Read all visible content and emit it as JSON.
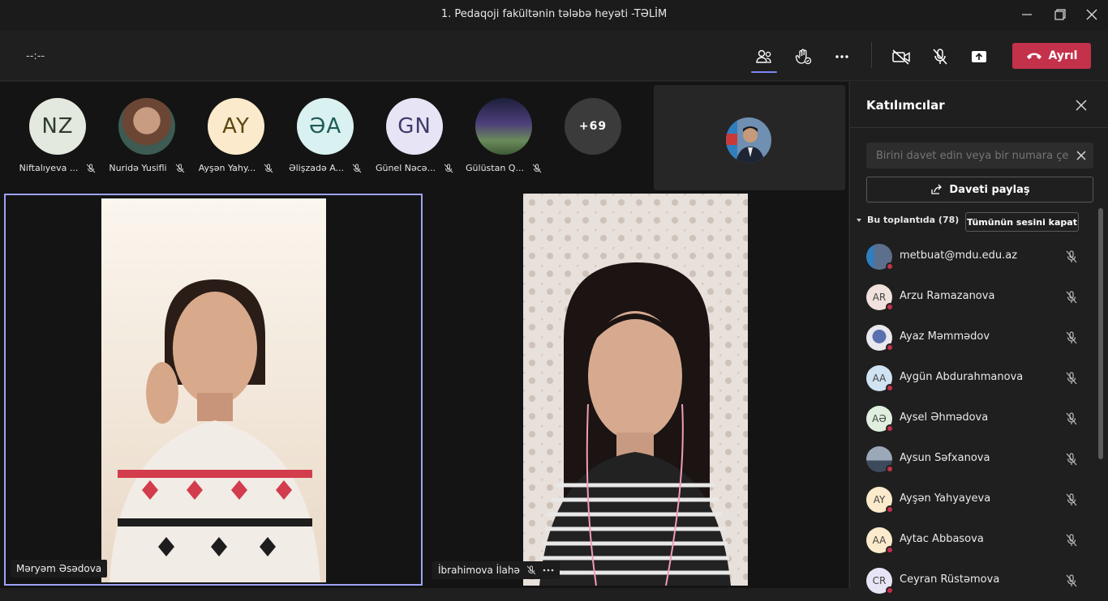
{
  "window": {
    "title": "1. Pedaqoji fakültənin tələbə heyəti -TƏLİM"
  },
  "toolbar": {
    "timer": "--:--",
    "leave_label": "Ayrıl"
  },
  "strip": {
    "participants": [
      {
        "initials": "NZ",
        "name": "Niftalıyeva ...",
        "bg": "#e3e9df",
        "fg": "#2f3b2c"
      },
      {
        "initials": "",
        "name": "Nuridə Yusifli",
        "bg": "#8a6a55",
        "fg": "#fff"
      },
      {
        "initials": "AY",
        "name": "Ayşən Yahy...",
        "bg": "#fbeacb",
        "fg": "#5c4612"
      },
      {
        "initials": "ƏA",
        "name": "Əlişzadə A...",
        "bg": "#d9f1f0",
        "fg": "#1f5a58"
      },
      {
        "initials": "GN",
        "name": "Günel Nəcə...",
        "bg": "#e7e4f5",
        "fg": "#3f3a6b"
      },
      {
        "initials": "",
        "name": "Gülüstan Q...",
        "bg": "#3a3b4a",
        "fg": "#fff"
      }
    ],
    "more_count": "+69"
  },
  "tiles": [
    {
      "name": "Məryəm Əsədova"
    },
    {
      "name": "İbrahimova İlahə"
    }
  ],
  "panel": {
    "title": "Katılımcılar",
    "invite_placeholder": "Birini davet edin veya bir numara çevirin",
    "share_label": "Daveti paylaş",
    "section_label": "Bu toplantıda (78)",
    "mute_all_label": "Tümünün sesini kapat",
    "people": [
      {
        "initials": "",
        "name": "metbuat@mdu.edu.az",
        "bg": "#4b5d7a"
      },
      {
        "initials": "AR",
        "name": "Arzu Ramazanova",
        "bg": "#f1e1dc"
      },
      {
        "initials": "",
        "name": "Ayaz Məmmədov",
        "bg": "#d8dbe3"
      },
      {
        "initials": "AA",
        "name": "Aygün Abdurahmanova",
        "bg": "#cfe3f2"
      },
      {
        "initials": "AƏ",
        "name": "Aysel Əhmədova",
        "bg": "#dfeede"
      },
      {
        "initials": "",
        "name": "Aysun Səfxanova",
        "bg": "#8c99a8"
      },
      {
        "initials": "AY",
        "name": "Ayşən Yahyayeva",
        "bg": "#fbeacb"
      },
      {
        "initials": "AA",
        "name": "Aytac Abbasova",
        "bg": "#fbeacb"
      },
      {
        "initials": "CR",
        "name": "Ceyran Rüstəmova",
        "bg": "#e7e4f5"
      }
    ]
  },
  "colors": {
    "accent": "#7f85f5",
    "leave": "#c4314b",
    "tile_border": "#9ea2ff"
  }
}
